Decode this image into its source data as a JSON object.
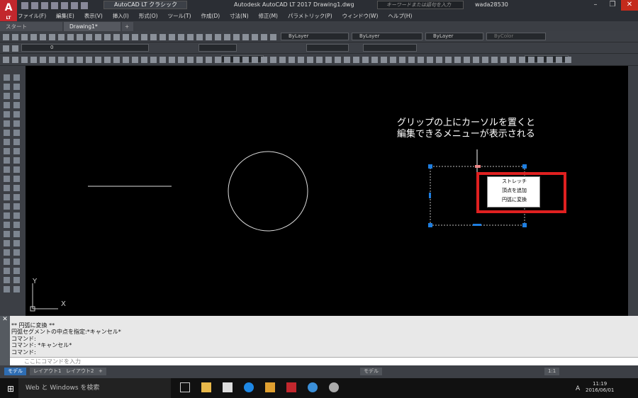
{
  "title": {
    "logo": "A",
    "logo_sub": "LT",
    "workspace": "AutoCAD LT クラシック",
    "window_title": "Autodesk AutoCAD LT 2017   Drawing1.dwg",
    "search_placeholder": "キーワードまたは語句を入力",
    "user": "wada28530"
  },
  "menu": [
    "ファイル(F)",
    "編集(E)",
    "表示(V)",
    "挿入(I)",
    "形式(O)",
    "ツール(T)",
    "作成(D)",
    "寸法(N)",
    "修正(M)",
    "パラメトリック(P)",
    "ウィンドウ(W)",
    "ヘルプ(H)"
  ],
  "tabs": {
    "start": "スタート",
    "drawing": "Drawing1*",
    "new_tab": "+"
  },
  "toolbar": {
    "layer_value": "0",
    "color": "ByLayer",
    "linetype": "ByLayer",
    "lineweight": "ByLayer",
    "plotstyle": "ByColor"
  },
  "annotation": "グリップの上にカーソルを置くと\n編集できるメニューが表示される",
  "context_menu": [
    "ストレッチ",
    "頂点を追加",
    "円弧に変換"
  ],
  "ucs": {
    "x": "X",
    "y": "Y"
  },
  "command_history": [
    "**  円弧に変換  **",
    "円弧セグメントの中点を指定:*キャンセル*",
    "コマンド:",
    "コマンド:  *キャンセル*",
    "コマンド:"
  ],
  "command_placeholder": "ここにコマンドを入力",
  "layout_tabs": [
    "モデル",
    "レイアウト1",
    "レイアウト2",
    "+"
  ],
  "status": {
    "model": "モデル",
    "scale": "1:1"
  },
  "taskbar": {
    "search": "Web と Windows を検索",
    "time": "11:19",
    "date": "2016/06/01",
    "ime": "A"
  },
  "colors": {
    "accent": "#c2272d",
    "grip": "#1e7ee0",
    "highlight": "#e02020"
  }
}
